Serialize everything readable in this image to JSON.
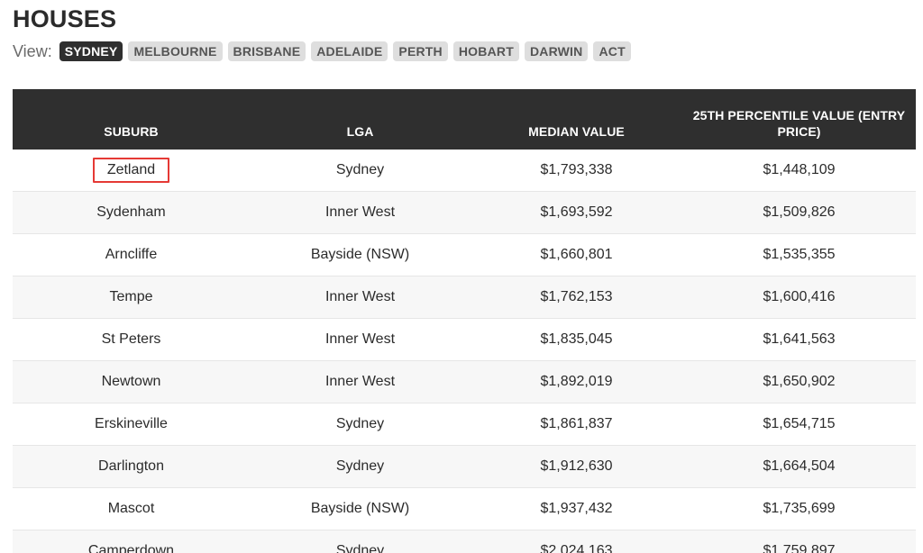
{
  "title": "HOUSES",
  "view": {
    "label": "View:",
    "options": [
      {
        "label": "SYDNEY",
        "active": true
      },
      {
        "label": "MELBOURNE",
        "active": false
      },
      {
        "label": "BRISBANE",
        "active": false
      },
      {
        "label": "ADELAIDE",
        "active": false
      },
      {
        "label": "PERTH",
        "active": false
      },
      {
        "label": "HOBART",
        "active": false
      },
      {
        "label": "DARWIN",
        "active": false
      },
      {
        "label": "ACT",
        "active": false
      }
    ]
  },
  "table": {
    "headers": [
      "SUBURB",
      "LGA",
      "MEDIAN VALUE",
      "25TH PERCENTILE VALUE (ENTRY PRICE)"
    ],
    "rows": [
      [
        "Zetland",
        "Sydney",
        "$1,793,338",
        "$1,448,109"
      ],
      [
        "Sydenham",
        "Inner West",
        "$1,693,592",
        "$1,509,826"
      ],
      [
        "Arncliffe",
        "Bayside (NSW)",
        "$1,660,801",
        "$1,535,355"
      ],
      [
        "Tempe",
        "Inner West",
        "$1,762,153",
        "$1,600,416"
      ],
      [
        "St Peters",
        "Inner West",
        "$1,835,045",
        "$1,641,563"
      ],
      [
        "Newtown",
        "Inner West",
        "$1,892,019",
        "$1,650,902"
      ],
      [
        "Erskineville",
        "Sydney",
        "$1,861,837",
        "$1,654,715"
      ],
      [
        "Darlington",
        "Sydney",
        "$1,912,630",
        "$1,664,504"
      ],
      [
        "Mascot",
        "Bayside (NSW)",
        "$1,937,432",
        "$1,735,699"
      ],
      [
        "Camperdown",
        "Sydney",
        "$2,024,163",
        "$1,759,897"
      ]
    ],
    "highlighted_row": 0
  },
  "colors": {
    "header_bg": "#2f2f2f",
    "highlight_border": "#e53935"
  }
}
